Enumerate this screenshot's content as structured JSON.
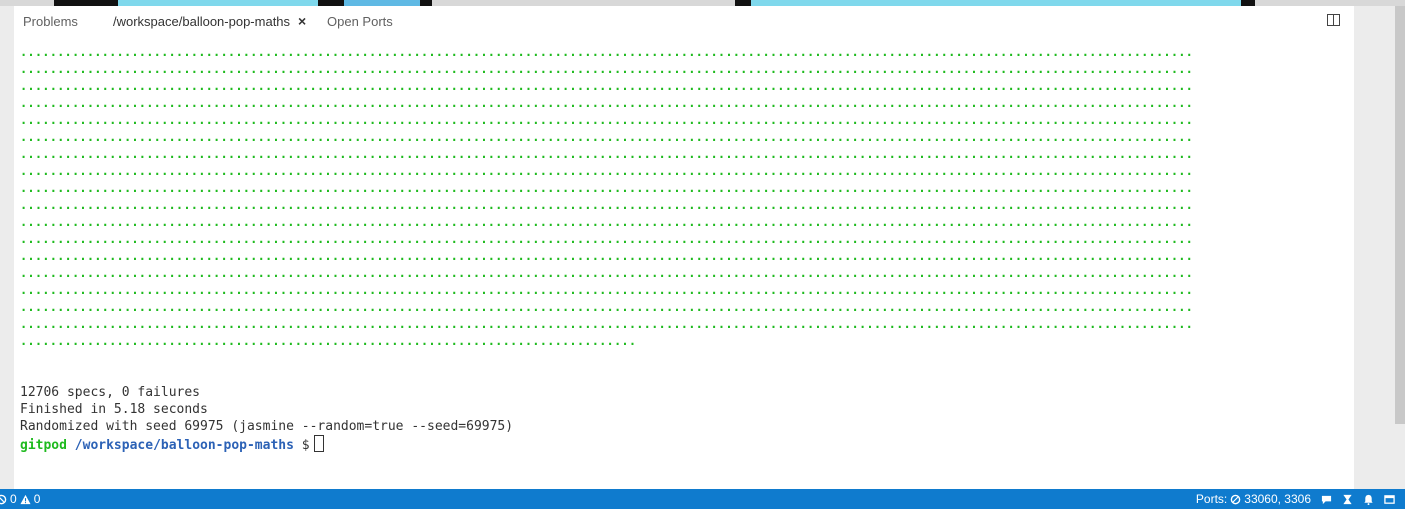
{
  "tabs": [
    {
      "label": "Problems"
    },
    {
      "label": "/workspace/balloon-pop-maths"
    },
    {
      "label": "Open Ports"
    }
  ],
  "tab_close_glyph": "×",
  "terminal": {
    "dot_rows": [
      "..............................................................................................................................................................",
      "..............................................................................................................................................................",
      "..............................................................................................................................................................",
      "..............................................................................................................................................................",
      "..............................................................................................................................................................",
      "..............................................................................................................................................................",
      "..............................................................................................................................................................",
      "..............................................................................................................................................................",
      "..............................................................................................................................................................",
      "..............................................................................................................................................................",
      "..............................................................................................................................................................",
      "..............................................................................................................................................................",
      "..............................................................................................................................................................",
      "..............................................................................................................................................................",
      "..............................................................................................................................................................",
      "..............................................................................................................................................................",
      "..............................................................................................................................................................",
      "..................................................................................."
    ],
    "summary": "12706 specs, 0 failures",
    "finished": "Finished in 5.18 seconds",
    "randomized": "Randomized with seed 69975 (jasmine --random=true --seed=69975)",
    "prompt_user": "gitpod",
    "prompt_path": "/workspace/balloon-pop-maths",
    "prompt_symbol": "$"
  },
  "status": {
    "errors": "0",
    "warnings": "0",
    "ports_label": "Ports:",
    "ports_value": "33060, 3306"
  },
  "colors": {
    "statusbar": "#0f7bce",
    "dots": "#1fba1f",
    "prompt_path": "#2c62b6"
  }
}
